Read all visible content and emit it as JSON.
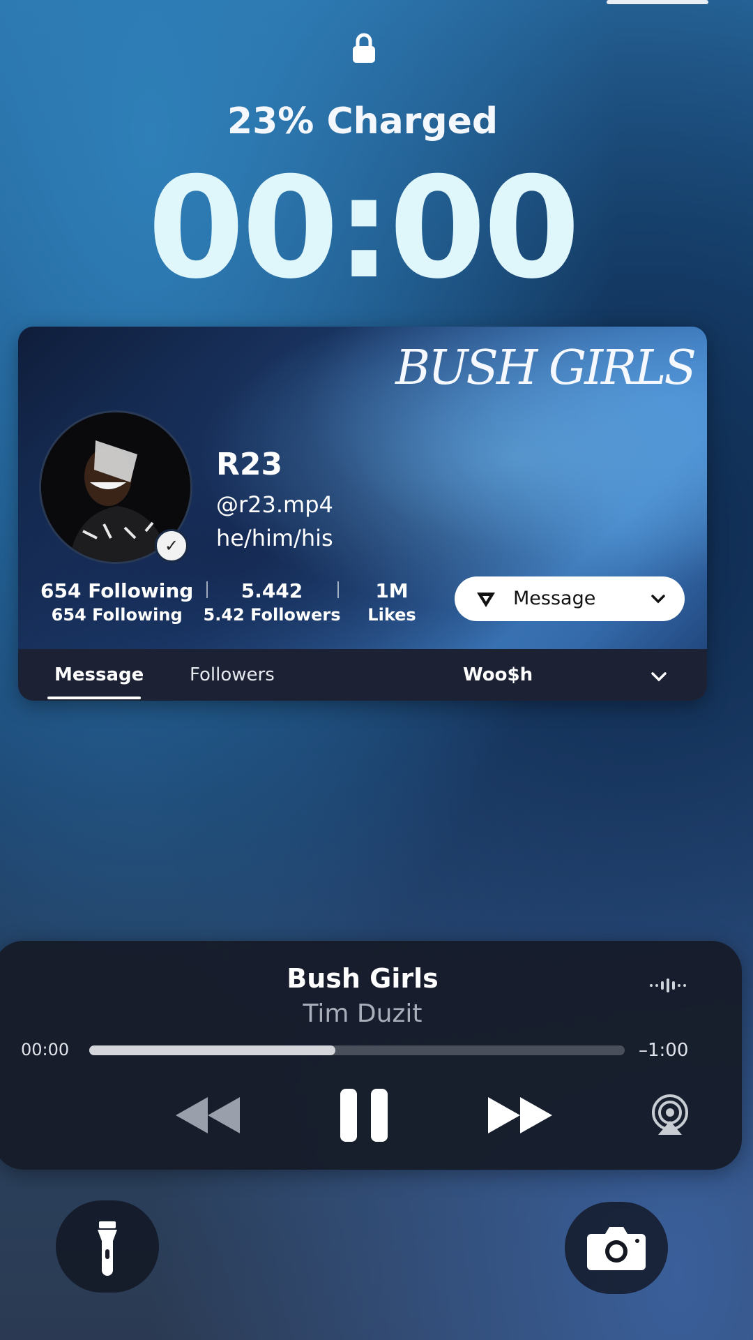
{
  "lockscreen": {
    "charge_text": "23% Charged",
    "time": "00:00",
    "icons": {
      "lock": "lock-icon"
    }
  },
  "profile_card": {
    "brand_text": "BUSH GIRLS",
    "name": "R23",
    "handle": "@r23.mp4",
    "pronouns": "he/him/his",
    "stats": [
      {
        "value": "654 Following",
        "label": "654 Following"
      },
      {
        "value": "5.442",
        "label": "5.42 Followers"
      },
      {
        "value": "1M",
        "label": "Likes"
      }
    ],
    "message_button": "Message",
    "tabs": [
      "Message",
      "Followers",
      "Woo$h"
    ]
  },
  "player": {
    "song": "Bush Girls",
    "artist": "Tim Duzit",
    "elapsed": "00:00",
    "remaining": "–1:00",
    "progress": 0.46,
    "icons": [
      "rewind-icon",
      "pause-icon",
      "fast-forward-icon",
      "airplay-icon",
      "waveform-icon"
    ]
  },
  "quick_actions": {
    "flashlight": "flashlight-icon",
    "camera": "camera-icon"
  }
}
